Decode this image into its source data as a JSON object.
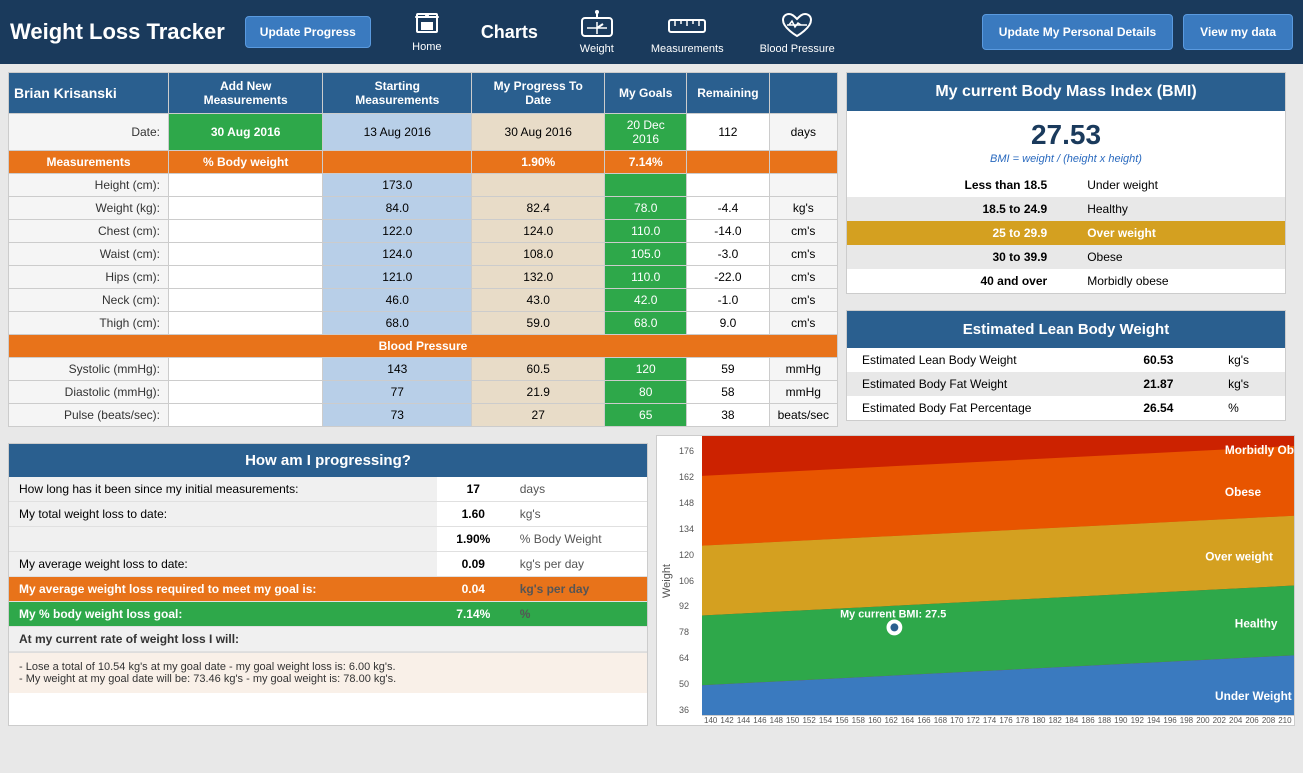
{
  "header": {
    "title": "Weight Loss Tracker",
    "btn_update_progress": "Update Progress",
    "btn_personal": "Update My Personal Details",
    "btn_view": "View my data",
    "nav_home": "Home",
    "nav_weight": "Weight",
    "nav_measurements": "Measurements",
    "nav_blood_pressure": "Blood Pressure",
    "nav_charts": "Charts"
  },
  "table": {
    "user_name": "Brian Krisanski",
    "col_add": "Add New Measurements",
    "col_starting": "Starting Measurements",
    "col_progress": "My Progress To Date",
    "col_goals": "My Goals",
    "col_remaining": "Remaining",
    "date_label": "Date:",
    "date_add": "30 Aug 2016",
    "date_start": "13 Aug 2016",
    "date_progress": "30 Aug 2016",
    "date_goal": "20 Dec 2016",
    "date_remaining": "112",
    "date_unit": "days",
    "measurements_label": "Measurements",
    "pct_body": "% Body weight",
    "pct_progress": "1.90%",
    "pct_goal": "7.14%",
    "rows": [
      {
        "label": "Height (cm):",
        "start": "173.0",
        "progress": "",
        "goal": "",
        "remaining": "",
        "unit": ""
      },
      {
        "label": "Weight (kg):",
        "start": "84.0",
        "progress": "82.4",
        "goal": "78.0",
        "remaining": "-4.4",
        "unit": "kg's"
      },
      {
        "label": "Chest (cm):",
        "start": "122.0",
        "progress": "124.0",
        "goal": "110.0",
        "remaining": "-14.0",
        "unit": "cm's"
      },
      {
        "label": "Waist (cm):",
        "start": "124.0",
        "progress": "108.0",
        "goal": "105.0",
        "remaining": "-3.0",
        "unit": "cm's"
      },
      {
        "label": "Hips (cm):",
        "start": "121.0",
        "progress": "132.0",
        "goal": "110.0",
        "remaining": "-22.0",
        "unit": "cm's"
      },
      {
        "label": "Neck (cm):",
        "start": "46.0",
        "progress": "43.0",
        "goal": "42.0",
        "remaining": "-1.0",
        "unit": "cm's"
      },
      {
        "label": "Thigh (cm):",
        "start": "68.0",
        "progress": "59.0",
        "goal": "68.0",
        "remaining": "9.0",
        "unit": "cm's"
      }
    ],
    "bp_label": "Blood Pressure",
    "bp_rows": [
      {
        "label": "Systolic (mmHg):",
        "start": "143",
        "progress": "60.5",
        "goal": "120",
        "remaining": "59",
        "unit": "mmHg"
      },
      {
        "label": "Diastolic (mmHg):",
        "start": "77",
        "progress": "21.9",
        "goal": "80",
        "remaining": "58",
        "unit": "mmHg"
      },
      {
        "label": "Pulse (beats/sec):",
        "start": "73",
        "progress": "27",
        "goal": "65",
        "remaining": "38",
        "unit": "beats/sec"
      }
    ]
  },
  "bmi": {
    "title": "My current Body Mass Index (BMI)",
    "value": "27.53",
    "formula": "BMI = weight / (height x height)",
    "ranges": [
      {
        "range": "Less than 18.5",
        "label": "Under weight",
        "highlight": false
      },
      {
        "range": "18.5 to 24.9",
        "label": "Healthy",
        "highlight": false
      },
      {
        "range": "25 to 29.9",
        "label": "Over weight",
        "highlight": true
      },
      {
        "range": "30 to 39.9",
        "label": "Obese",
        "highlight": false
      },
      {
        "range": "40 and over",
        "label": "Morbidly obese",
        "highlight": false
      }
    ]
  },
  "lean": {
    "title": "Estimated Lean Body Weight",
    "rows": [
      {
        "label": "Estimated Lean Body Weight",
        "value": "60.53",
        "unit": "kg's"
      },
      {
        "label": "Estimated Body Fat Weight",
        "value": "21.87",
        "unit": "kg's"
      },
      {
        "label": "Estimated Body Fat Percentage",
        "value": "26.54",
        "unit": "%"
      }
    ]
  },
  "progress": {
    "title": "How am I progressing?",
    "rows": [
      {
        "label": "How long has it been since my initial measurements:",
        "value": "17",
        "unit": "days",
        "type": "normal"
      },
      {
        "label": "My total weight loss to date:",
        "value": "1.60",
        "unit": "kg's",
        "type": "normal"
      },
      {
        "label": "",
        "value": "1.90%",
        "unit": "% Body Weight",
        "type": "normal"
      },
      {
        "label": "My average weight loss to date:",
        "value": "0.09",
        "unit": "kg's per day",
        "type": "normal"
      },
      {
        "label": "My average weight loss required to meet my goal is:",
        "value": "0.04",
        "unit": "kg's per day",
        "type": "orange"
      },
      {
        "label": "My % body weight loss goal:",
        "value": "7.14%",
        "unit": "%",
        "type": "green"
      },
      {
        "label": "At my current rate of weight loss I will:",
        "value": "",
        "unit": "",
        "type": "rate-header"
      }
    ],
    "note1": " - Lose a total of 10.54 kg's at my goal date - my goal weight loss is: 6.00 kg's.",
    "note2": " - My weight at my goal date will be: 73.46 kg's - my goal weight is: 78.00 kg's."
  },
  "chart": {
    "y_label": "Weight",
    "y_values": [
      "176",
      "162",
      "148",
      "134",
      "120",
      "106",
      "92",
      "78",
      "64",
      "50",
      "36"
    ],
    "x_values": [
      "140",
      "142",
      "144",
      "146",
      "148",
      "150",
      "152",
      "154",
      "156",
      "158",
      "160",
      "162",
      "164",
      "166",
      "168",
      "170",
      "172",
      "174",
      "176",
      "178",
      "180",
      "182",
      "184",
      "186",
      "188",
      "190",
      "192",
      "194",
      "196",
      "198",
      "200",
      "202",
      "204",
      "206",
      "208",
      "210"
    ],
    "zones": [
      {
        "label": "Morbidly Obese",
        "color": "#cc2200"
      },
      {
        "label": "Obese",
        "color": "#e85500"
      },
      {
        "label": "Over weight",
        "color": "#d4a020"
      },
      {
        "label": "Healthy",
        "color": "#2ea84a"
      },
      {
        "label": "Under Weight",
        "color": "#3a7abf"
      }
    ],
    "current_bmi": "My current BMI: 27.5"
  }
}
